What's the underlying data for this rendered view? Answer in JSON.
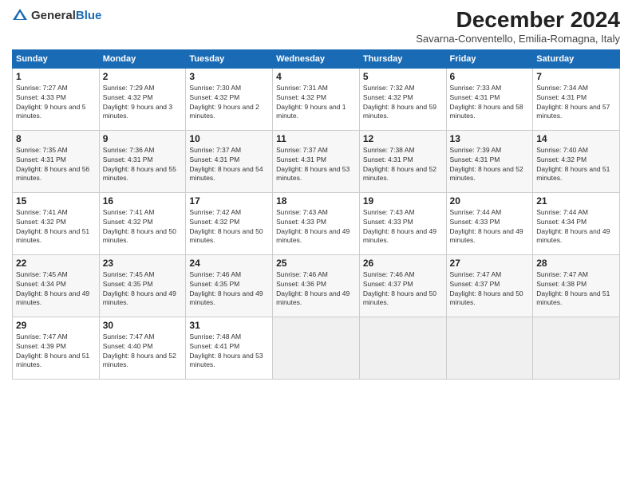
{
  "logo": {
    "text_general": "General",
    "text_blue": "Blue"
  },
  "title": "December 2024",
  "subtitle": "Savarna-Conventello, Emilia-Romagna, Italy",
  "days_of_week": [
    "Sunday",
    "Monday",
    "Tuesday",
    "Wednesday",
    "Thursday",
    "Friday",
    "Saturday"
  ],
  "weeks": [
    [
      {
        "day": "1",
        "sunrise": "Sunrise: 7:27 AM",
        "sunset": "Sunset: 4:33 PM",
        "daylight": "Daylight: 9 hours and 5 minutes."
      },
      {
        "day": "2",
        "sunrise": "Sunrise: 7:29 AM",
        "sunset": "Sunset: 4:32 PM",
        "daylight": "Daylight: 9 hours and 3 minutes."
      },
      {
        "day": "3",
        "sunrise": "Sunrise: 7:30 AM",
        "sunset": "Sunset: 4:32 PM",
        "daylight": "Daylight: 9 hours and 2 minutes."
      },
      {
        "day": "4",
        "sunrise": "Sunrise: 7:31 AM",
        "sunset": "Sunset: 4:32 PM",
        "daylight": "Daylight: 9 hours and 1 minute."
      },
      {
        "day": "5",
        "sunrise": "Sunrise: 7:32 AM",
        "sunset": "Sunset: 4:32 PM",
        "daylight": "Daylight: 8 hours and 59 minutes."
      },
      {
        "day": "6",
        "sunrise": "Sunrise: 7:33 AM",
        "sunset": "Sunset: 4:31 PM",
        "daylight": "Daylight: 8 hours and 58 minutes."
      },
      {
        "day": "7",
        "sunrise": "Sunrise: 7:34 AM",
        "sunset": "Sunset: 4:31 PM",
        "daylight": "Daylight: 8 hours and 57 minutes."
      }
    ],
    [
      {
        "day": "8",
        "sunrise": "Sunrise: 7:35 AM",
        "sunset": "Sunset: 4:31 PM",
        "daylight": "Daylight: 8 hours and 56 minutes."
      },
      {
        "day": "9",
        "sunrise": "Sunrise: 7:36 AM",
        "sunset": "Sunset: 4:31 PM",
        "daylight": "Daylight: 8 hours and 55 minutes."
      },
      {
        "day": "10",
        "sunrise": "Sunrise: 7:37 AM",
        "sunset": "Sunset: 4:31 PM",
        "daylight": "Daylight: 8 hours and 54 minutes."
      },
      {
        "day": "11",
        "sunrise": "Sunrise: 7:37 AM",
        "sunset": "Sunset: 4:31 PM",
        "daylight": "Daylight: 8 hours and 53 minutes."
      },
      {
        "day": "12",
        "sunrise": "Sunrise: 7:38 AM",
        "sunset": "Sunset: 4:31 PM",
        "daylight": "Daylight: 8 hours and 52 minutes."
      },
      {
        "day": "13",
        "sunrise": "Sunrise: 7:39 AM",
        "sunset": "Sunset: 4:31 PM",
        "daylight": "Daylight: 8 hours and 52 minutes."
      },
      {
        "day": "14",
        "sunrise": "Sunrise: 7:40 AM",
        "sunset": "Sunset: 4:32 PM",
        "daylight": "Daylight: 8 hours and 51 minutes."
      }
    ],
    [
      {
        "day": "15",
        "sunrise": "Sunrise: 7:41 AM",
        "sunset": "Sunset: 4:32 PM",
        "daylight": "Daylight: 8 hours and 51 minutes."
      },
      {
        "day": "16",
        "sunrise": "Sunrise: 7:41 AM",
        "sunset": "Sunset: 4:32 PM",
        "daylight": "Daylight: 8 hours and 50 minutes."
      },
      {
        "day": "17",
        "sunrise": "Sunrise: 7:42 AM",
        "sunset": "Sunset: 4:32 PM",
        "daylight": "Daylight: 8 hours and 50 minutes."
      },
      {
        "day": "18",
        "sunrise": "Sunrise: 7:43 AM",
        "sunset": "Sunset: 4:33 PM",
        "daylight": "Daylight: 8 hours and 49 minutes."
      },
      {
        "day": "19",
        "sunrise": "Sunrise: 7:43 AM",
        "sunset": "Sunset: 4:33 PM",
        "daylight": "Daylight: 8 hours and 49 minutes."
      },
      {
        "day": "20",
        "sunrise": "Sunrise: 7:44 AM",
        "sunset": "Sunset: 4:33 PM",
        "daylight": "Daylight: 8 hours and 49 minutes."
      },
      {
        "day": "21",
        "sunrise": "Sunrise: 7:44 AM",
        "sunset": "Sunset: 4:34 PM",
        "daylight": "Daylight: 8 hours and 49 minutes."
      }
    ],
    [
      {
        "day": "22",
        "sunrise": "Sunrise: 7:45 AM",
        "sunset": "Sunset: 4:34 PM",
        "daylight": "Daylight: 8 hours and 49 minutes."
      },
      {
        "day": "23",
        "sunrise": "Sunrise: 7:45 AM",
        "sunset": "Sunset: 4:35 PM",
        "daylight": "Daylight: 8 hours and 49 minutes."
      },
      {
        "day": "24",
        "sunrise": "Sunrise: 7:46 AM",
        "sunset": "Sunset: 4:35 PM",
        "daylight": "Daylight: 8 hours and 49 minutes."
      },
      {
        "day": "25",
        "sunrise": "Sunrise: 7:46 AM",
        "sunset": "Sunset: 4:36 PM",
        "daylight": "Daylight: 8 hours and 49 minutes."
      },
      {
        "day": "26",
        "sunrise": "Sunrise: 7:46 AM",
        "sunset": "Sunset: 4:37 PM",
        "daylight": "Daylight: 8 hours and 50 minutes."
      },
      {
        "day": "27",
        "sunrise": "Sunrise: 7:47 AM",
        "sunset": "Sunset: 4:37 PM",
        "daylight": "Daylight: 8 hours and 50 minutes."
      },
      {
        "day": "28",
        "sunrise": "Sunrise: 7:47 AM",
        "sunset": "Sunset: 4:38 PM",
        "daylight": "Daylight: 8 hours and 51 minutes."
      }
    ],
    [
      {
        "day": "29",
        "sunrise": "Sunrise: 7:47 AM",
        "sunset": "Sunset: 4:39 PM",
        "daylight": "Daylight: 8 hours and 51 minutes."
      },
      {
        "day": "30",
        "sunrise": "Sunrise: 7:47 AM",
        "sunset": "Sunset: 4:40 PM",
        "daylight": "Daylight: 8 hours and 52 minutes."
      },
      {
        "day": "31",
        "sunrise": "Sunrise: 7:48 AM",
        "sunset": "Sunset: 4:41 PM",
        "daylight": "Daylight: 8 hours and 53 minutes."
      },
      null,
      null,
      null,
      null
    ]
  ]
}
